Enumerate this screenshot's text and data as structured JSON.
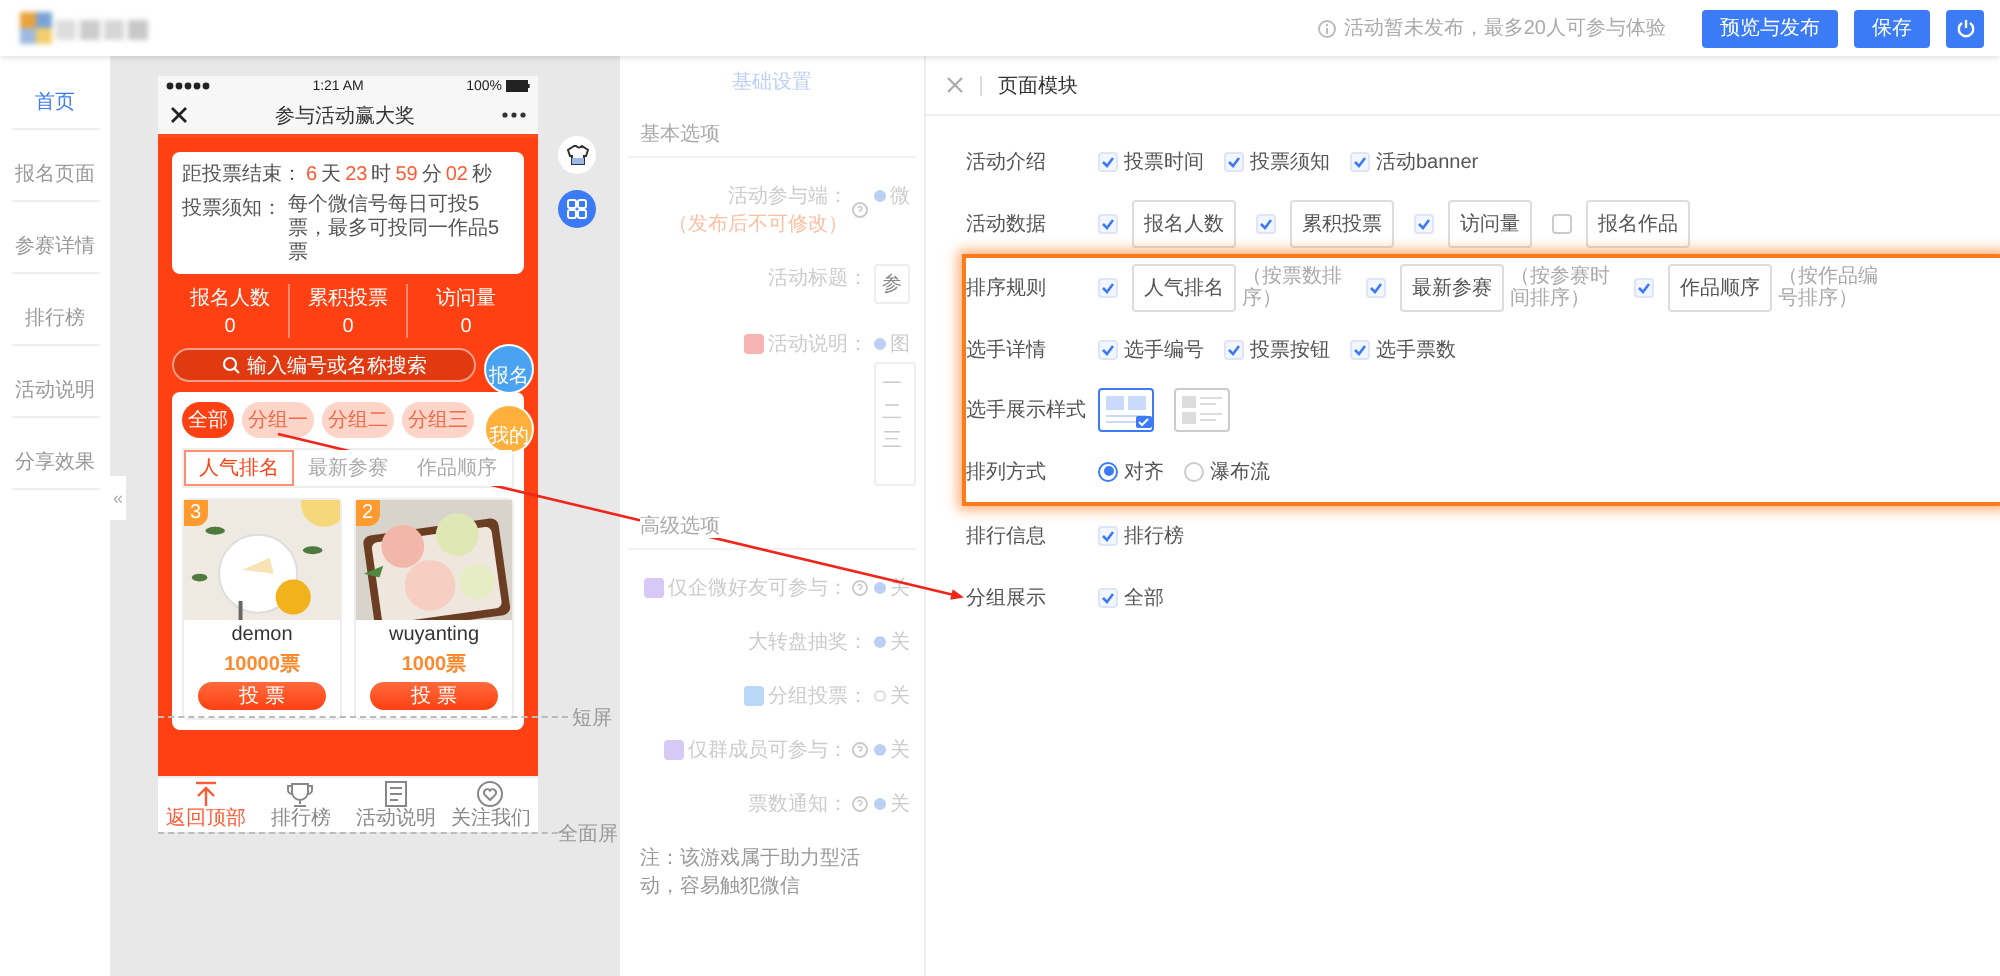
{
  "header": {
    "notice": "活动暂未发布，最多20人可参与体验",
    "buttons": [
      {
        "label": "预览与发布"
      },
      {
        "label": "保存"
      }
    ]
  },
  "nav": {
    "items": [
      {
        "label": "首页",
        "selected": true
      },
      {
        "label": "报名页面",
        "selected": false
      },
      {
        "label": "参赛详情",
        "selected": false
      },
      {
        "label": "排行榜",
        "selected": false
      },
      {
        "label": "活动说明",
        "selected": false
      },
      {
        "label": "分享效果",
        "selected": false
      }
    ]
  },
  "collapse_handle": "«",
  "phone": {
    "time": "1:21 AM",
    "battery": "100%",
    "title": "参与活动赢大奖",
    "countdown": {
      "label": "距投票结束：",
      "parts": [
        {
          "value": "6",
          "unit": "天"
        },
        {
          "value": "23",
          "unit": "时"
        },
        {
          "value": "59",
          "unit": "分"
        },
        {
          "value": "02",
          "unit": "秒"
        }
      ]
    },
    "notice": {
      "label": "投票须知：",
      "text": "每个微信号每日可投5票，最多可投同一作品5票"
    },
    "stats": [
      {
        "label": "报名人数",
        "value": "0"
      },
      {
        "label": "累积投票",
        "value": "0"
      },
      {
        "label": "访问量",
        "value": "0"
      }
    ],
    "search": {
      "placeholder": "输入编号或名称搜索"
    },
    "float_buttons": [
      {
        "label": "报名"
      },
      {
        "label": "我的"
      }
    ],
    "groups": [
      {
        "label": "全部",
        "selected": true
      },
      {
        "label": "分组一",
        "selected": false
      },
      {
        "label": "分组二",
        "selected": false
      },
      {
        "label": "分组三",
        "selected": false
      }
    ],
    "sort_tabs": [
      {
        "label": "人气排名",
        "selected": true
      },
      {
        "label": "最新参赛",
        "selected": false
      },
      {
        "label": "作品顺序",
        "selected": false
      }
    ],
    "cards": [
      {
        "rank": "3",
        "name": "demon",
        "votes": "10000票",
        "button": "投 票"
      },
      {
        "rank": "2",
        "name": "wuyanting",
        "votes": "1000票",
        "button": "投 票"
      }
    ],
    "tabbar": [
      {
        "label": "返回顶部",
        "selected": true
      },
      {
        "label": "排行榜",
        "selected": false
      },
      {
        "label": "活动说明",
        "selected": false
      },
      {
        "label": "关注我们",
        "selected": false
      }
    ]
  },
  "screen_marks": [
    {
      "label": "短屏"
    },
    {
      "label": "全面屏"
    }
  ],
  "settings": {
    "tab": "基础设置",
    "sections": [
      {
        "title": "基本选项",
        "rows": [
          {
            "label": "活动参与端：",
            "note": "（发布后不可修改）",
            "help": true,
            "kind": "radio",
            "value": "微",
            "selected": true
          },
          {
            "label": "活动标题：",
            "kind": "input",
            "value": "参"
          },
          {
            "label": "活动说明：",
            "color": "#f8b4b4",
            "kind": "radio",
            "value": "图",
            "selected": true,
            "lines": [
              "一",
              "二",
              "三"
            ]
          }
        ]
      },
      {
        "title": "高级选项",
        "rows": [
          {
            "label": "仅企微好友可参与：",
            "color": "#d7c8f5",
            "help": true,
            "kind": "radio",
            "value": "关",
            "selected": true
          },
          {
            "label": "大转盘抽奖：",
            "kind": "radio",
            "value": "关",
            "selected": true
          },
          {
            "label": "分组投票：",
            "color": "#b9d8f7",
            "kind": "radio",
            "value": "关",
            "selected": false
          },
          {
            "label": "仅群成员可参与：",
            "color": "#d7c8f5",
            "help": true,
            "kind": "radio",
            "value": "关",
            "selected": true
          },
          {
            "label": "票数通知：",
            "help": true,
            "kind": "radio",
            "value": "关",
            "selected": true
          }
        ]
      }
    ],
    "footnote": "注：该游戏属于助力型活动，容易触犯微信"
  },
  "drawer": {
    "title": "页面模块",
    "rows": [
      {
        "label": "活动介绍",
        "kind": "checks",
        "highlighted": false,
        "options": [
          {
            "label": "投票时间",
            "checked": true
          },
          {
            "label": "投票须知",
            "checked": true
          },
          {
            "label": "活动banner",
            "checked": true
          }
        ]
      },
      {
        "label": "活动数据",
        "kind": "inputs",
        "highlighted": false,
        "options": [
          {
            "value": "报名人数",
            "checked": true
          },
          {
            "value": "累积投票",
            "checked": true
          },
          {
            "value": "访问量",
            "checked": true
          },
          {
            "value": "报名作品",
            "checked": false
          }
        ]
      },
      {
        "label": "排序规则",
        "kind": "inputs",
        "highlighted": true,
        "options": [
          {
            "value": "人气排名",
            "hint": "（按票数排序）",
            "checked": true
          },
          {
            "value": "最新参赛",
            "hint": "（按参赛时间排序）",
            "checked": true
          },
          {
            "value": "作品顺序",
            "hint": "（按作品编号排序）",
            "checked": true
          }
        ]
      },
      {
        "label": "选手详情",
        "kind": "checks",
        "highlighted": true,
        "options": [
          {
            "label": "选手编号",
            "checked": true
          },
          {
            "label": "投票按钮",
            "checked": true
          },
          {
            "label": "选手票数",
            "checked": true
          }
        ]
      },
      {
        "label": "选手展示样式",
        "kind": "styles",
        "highlighted": true,
        "options": [
          {
            "kind": "grid",
            "selected": true
          },
          {
            "kind": "list",
            "selected": false
          }
        ]
      },
      {
        "label": "排列方式",
        "kind": "radios",
        "highlighted": true,
        "options": [
          {
            "label": "对齐",
            "selected": true
          },
          {
            "label": "瀑布流",
            "selected": false
          }
        ]
      },
      {
        "label": "排行信息",
        "kind": "checks",
        "highlighted": false,
        "options": [
          {
            "label": "排行榜",
            "checked": true
          }
        ]
      },
      {
        "label": "分组展示",
        "kind": "checks",
        "highlighted": false,
        "options": [
          {
            "label": "全部",
            "checked": true
          }
        ]
      }
    ]
  }
}
